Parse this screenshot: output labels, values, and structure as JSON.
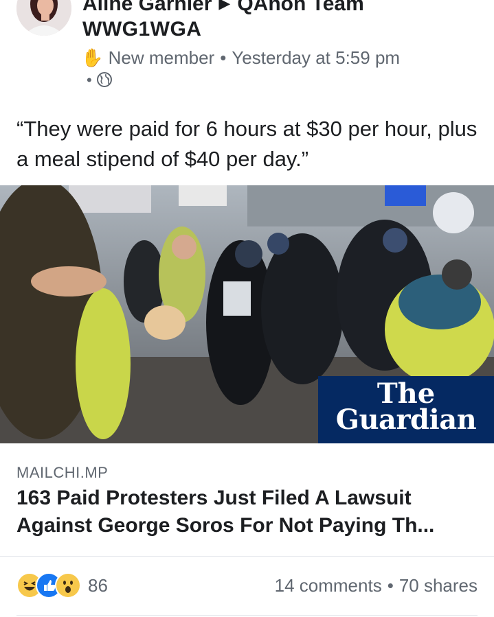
{
  "post": {
    "author": "Aline Garnier",
    "group": "QAnon Team",
    "group_subtitle": "WWG1WGA",
    "badge": "New member",
    "timestamp": "Yesterday at 5:59 pm",
    "privacy_icon": "globe-icon",
    "text": "“They were paid for 6 hours at $30 per hour, plus a meal stipend of $40 per day.”"
  },
  "image": {
    "watermark_line1": "The",
    "watermark_line2": "Guardian",
    "watermark_bg": "#052962"
  },
  "link": {
    "domain": "MAILCHI.MP",
    "headline": "163 Paid Protesters Just Filed A Lawsuit Against George Soros For Not Paying Th..."
  },
  "footer": {
    "reaction_icons": [
      "haha-icon",
      "like-icon",
      "wow-icon"
    ],
    "reaction_count": "86",
    "comments": "14 comments",
    "shares": "70 shares"
  },
  "colors": {
    "text": "#1c1e21",
    "secondary": "#606770",
    "like_blue": "#1877f2",
    "reaction_yellow": "#f7c84b"
  }
}
